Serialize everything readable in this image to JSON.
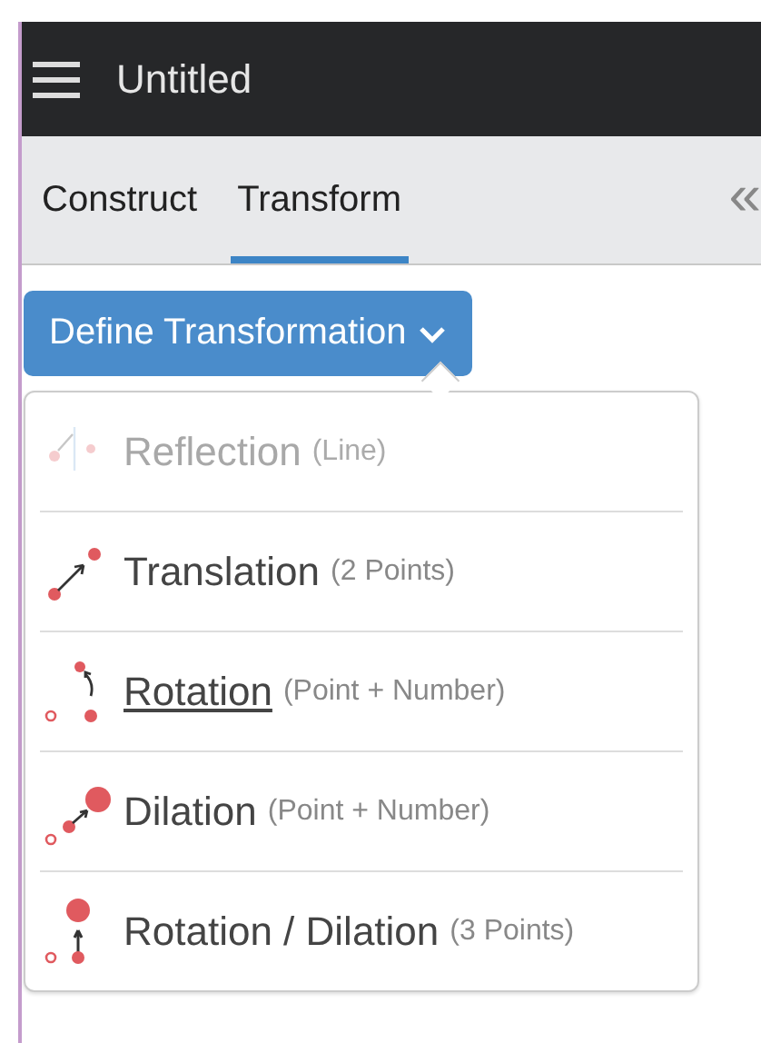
{
  "header": {
    "title": "Untitled"
  },
  "tabs": [
    {
      "label": "Construct",
      "selected": false
    },
    {
      "label": "Transform",
      "selected": true
    }
  ],
  "collapse": {
    "glyph": "«"
  },
  "dropdown": {
    "label": "Define Transformation",
    "expanded": true
  },
  "menu_items": [
    {
      "kind": "reflection",
      "label": "Reflection",
      "hint": "(Line)",
      "disabled": true,
      "highlighted": false
    },
    {
      "kind": "translation",
      "label": "Translation",
      "hint": "(2 Points)",
      "disabled": false,
      "highlighted": false
    },
    {
      "kind": "rotation",
      "label": "Rotation",
      "hint": "(Point + Number)",
      "disabled": false,
      "highlighted": true
    },
    {
      "kind": "dilation",
      "label": "Dilation",
      "hint": "(Point + Number)",
      "disabled": false,
      "highlighted": false
    },
    {
      "kind": "rotdil",
      "label": "Rotation / Dilation",
      "hint": "(3 Points)",
      "disabled": false,
      "highlighted": false
    }
  ]
}
